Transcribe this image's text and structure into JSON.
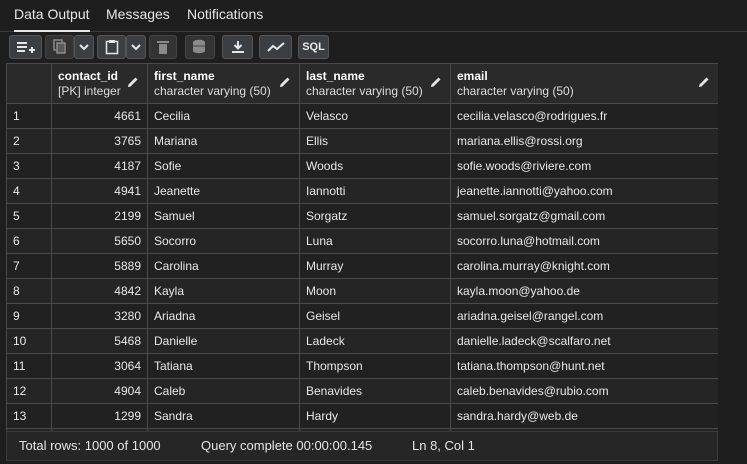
{
  "tabs": [
    {
      "label": "Data Output"
    },
    {
      "label": "Messages"
    },
    {
      "label": "Notifications"
    }
  ],
  "toolbar": {
    "sql_label": "SQL"
  },
  "columns": [
    {
      "name": "contact_id",
      "type": "[PK] integer"
    },
    {
      "name": "first_name",
      "type": "character varying (50)"
    },
    {
      "name": "last_name",
      "type": "character varying (50)"
    },
    {
      "name": "email",
      "type": "character varying (50)"
    }
  ],
  "rows": [
    {
      "n": "1",
      "id": "4661",
      "first": "Cecilia",
      "last": "Velasco",
      "email": "cecilia.velasco@rodrigues.fr"
    },
    {
      "n": "2",
      "id": "3765",
      "first": "Mariana",
      "last": "Ellis",
      "email": "mariana.ellis@rossi.org"
    },
    {
      "n": "3",
      "id": "4187",
      "first": "Sofie",
      "last": "Woods",
      "email": "sofie.woods@riviere.com"
    },
    {
      "n": "4",
      "id": "4941",
      "first": "Jeanette",
      "last": "Iannotti",
      "email": "jeanette.iannotti@yahoo.com"
    },
    {
      "n": "5",
      "id": "2199",
      "first": "Samuel",
      "last": "Sorgatz",
      "email": "samuel.sorgatz@gmail.com"
    },
    {
      "n": "6",
      "id": "5650",
      "first": "Socorro",
      "last": "Luna",
      "email": "socorro.luna@hotmail.com"
    },
    {
      "n": "7",
      "id": "5889",
      "first": "Carolina",
      "last": "Murray",
      "email": "carolina.murray@knight.com"
    },
    {
      "n": "8",
      "id": "4842",
      "first": "Kayla",
      "last": "Moon",
      "email": "kayla.moon@yahoo.de"
    },
    {
      "n": "9",
      "id": "3280",
      "first": "Ariadna",
      "last": "Geisel",
      "email": "ariadna.geisel@rangel.com"
    },
    {
      "n": "10",
      "id": "5468",
      "first": "Danielle",
      "last": "Ladeck",
      "email": "danielle.ladeck@scalfaro.net"
    },
    {
      "n": "11",
      "id": "3064",
      "first": "Tatiana",
      "last": "Thompson",
      "email": "tatiana.thompson@hunt.net"
    },
    {
      "n": "12",
      "id": "4904",
      "first": "Caleb",
      "last": "Benavides",
      "email": "caleb.benavides@rubio.com"
    },
    {
      "n": "13",
      "id": "1299",
      "first": "Sandra",
      "last": "Hardy",
      "email": "sandra.hardy@web.de"
    }
  ],
  "status": {
    "total_rows": "Total rows: 1000 of 1000",
    "query": "Query complete 00:00:00.145",
    "position": "Ln 8, Col 1"
  }
}
